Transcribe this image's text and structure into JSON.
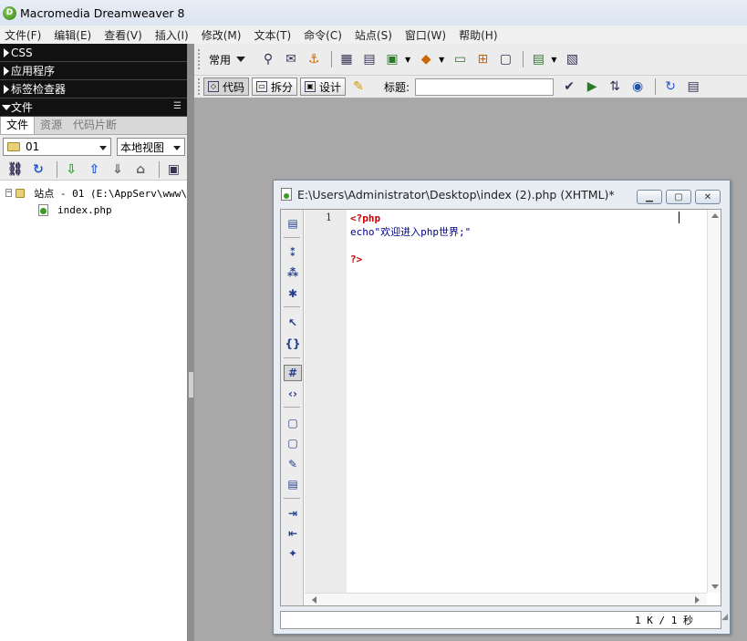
{
  "window": {
    "title": "Macromedia Dreamweaver 8"
  },
  "menu": [
    "文件(F)",
    "编辑(E)",
    "查看(V)",
    "插入(I)",
    "修改(M)",
    "文本(T)",
    "命令(C)",
    "站点(S)",
    "窗口(W)",
    "帮助(H)"
  ],
  "panels": {
    "css": "CSS",
    "app": "应用程序",
    "tag_inspector": "标签检查器",
    "files": "文件"
  },
  "file_tabs": [
    "文件",
    "资源",
    "代码片断"
  ],
  "site_select": "01",
  "view_select": "本地视图",
  "tree": {
    "site_label": "站点 - 01 (E:\\AppServ\\www\\",
    "file": "index.php"
  },
  "insert_bar": {
    "category": "常用"
  },
  "doc_toolbar": {
    "code": "代码",
    "split": "拆分",
    "design": "设计",
    "title_label": "标题:",
    "title_value": ""
  },
  "document": {
    "title": "E:\\Users\\Administrator\\Desktop\\index (2).php (XHTML)*",
    "line_numbers": [
      "1"
    ],
    "code_lines": [
      "<?php",
      "echo\"欢迎进入php世界;\"",
      "",
      "?>"
    ],
    "status": "1 K / 1 秒"
  }
}
